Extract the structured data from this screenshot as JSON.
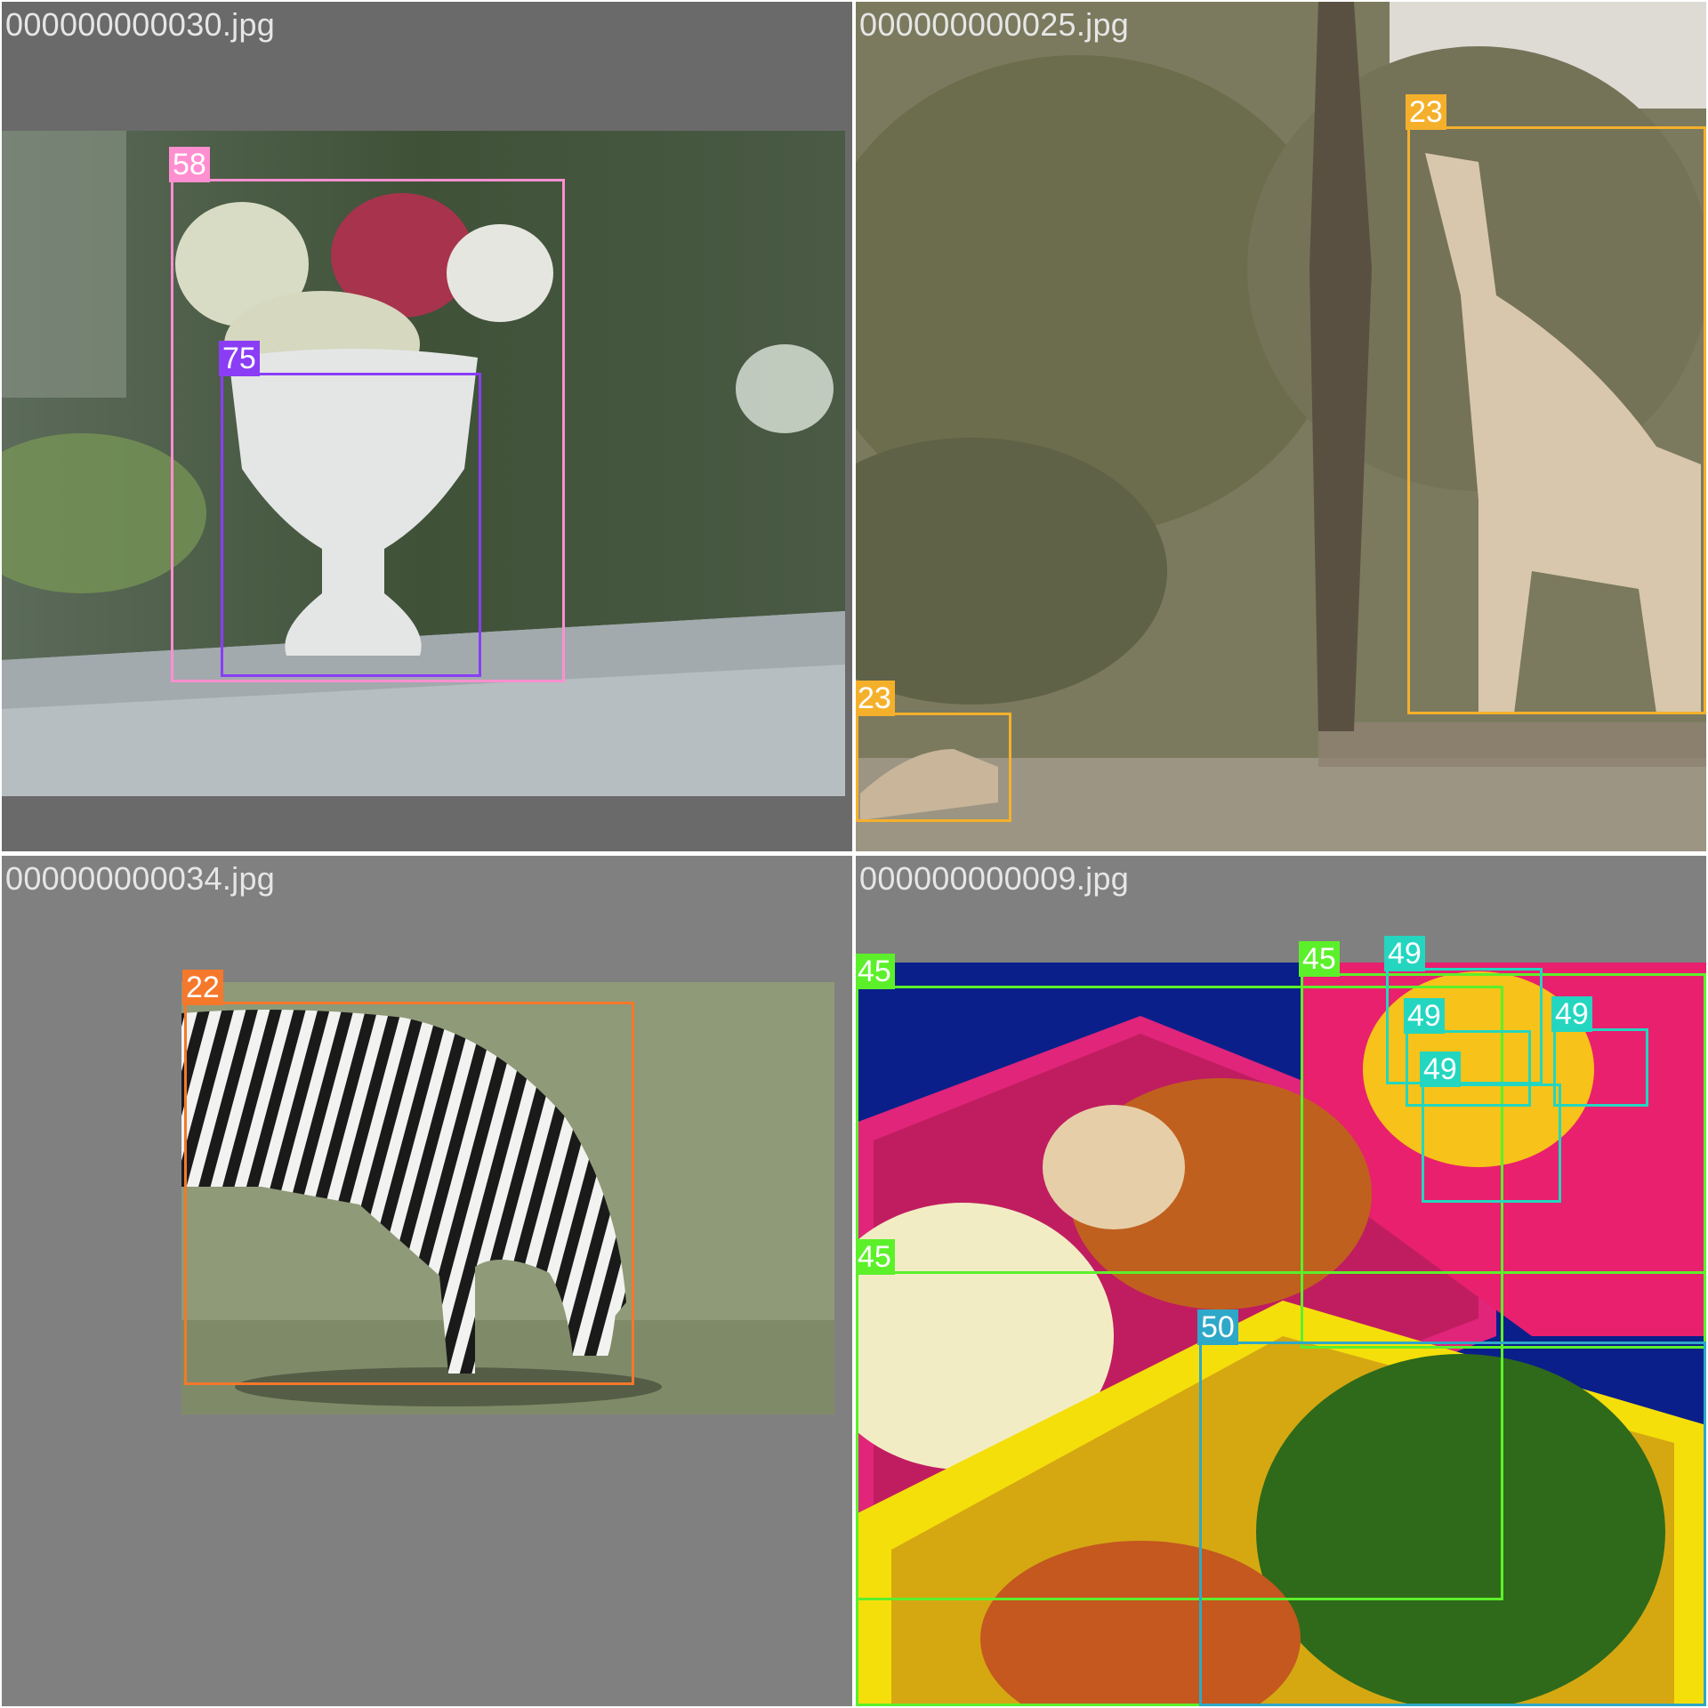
{
  "tiles": [
    {
      "filename": "000000000030.jpg",
      "labels": [
        "58",
        "75"
      ]
    },
    {
      "filename": "000000000025.jpg",
      "labels": [
        "23",
        "23"
      ]
    },
    {
      "filename": "000000000034.jpg",
      "labels": [
        "22"
      ]
    },
    {
      "filename": "000000000009.jpg",
      "labels": [
        "45",
        "45",
        "45",
        "49",
        "49",
        "49",
        "49",
        "50"
      ]
    }
  ],
  "colors": {
    "class_58": "#ff8fd0",
    "class_75": "#8a3df5",
    "class_23": "#f5b02b",
    "class_22": "#f5782b",
    "class_45": "#5cf02b",
    "class_49": "#24d6c0",
    "class_50": "#2ea8c8"
  }
}
